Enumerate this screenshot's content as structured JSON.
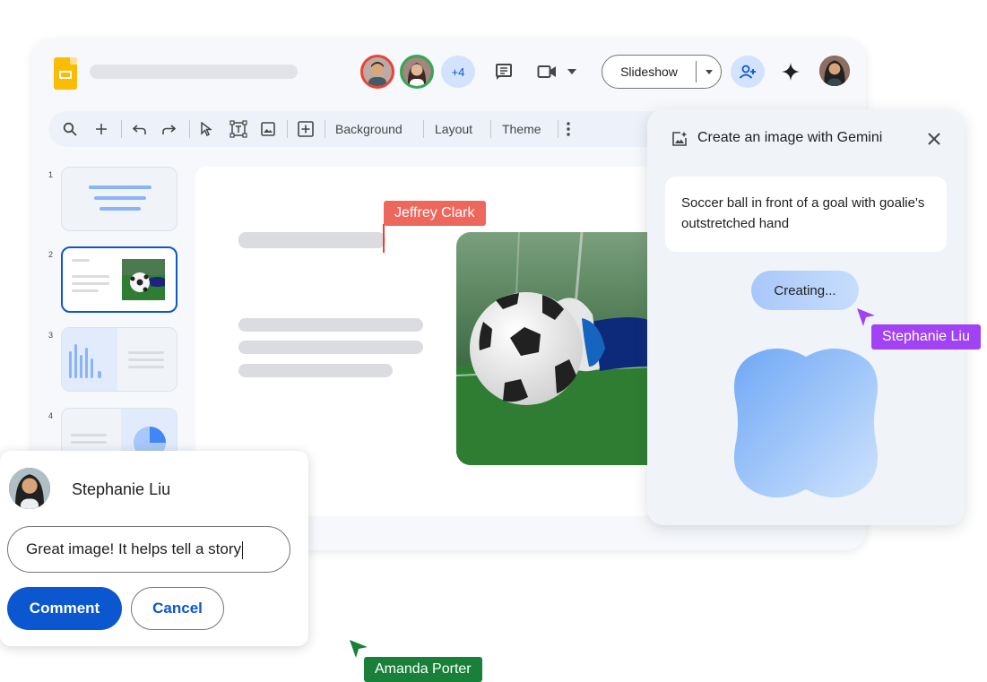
{
  "header": {
    "app_icon": "slides-logo-icon",
    "collaborators_extra": "+4",
    "slideshow_label": "Slideshow"
  },
  "toolbar": {
    "background_label": "Background",
    "layout_label": "Layout",
    "theme_label": "Theme"
  },
  "slides": {
    "numbers": [
      "1",
      "2",
      "3",
      "4"
    ],
    "selected": "2"
  },
  "cursors": {
    "jeffrey": "Jeffrey Clark",
    "stephanie": "Stephanie Liu",
    "amanda": "Amanda Porter"
  },
  "gemini": {
    "title": "Create an image with Gemini",
    "prompt": "Soccer ball in front of a goal with goalie's outstretched hand",
    "status": "Creating..."
  },
  "comment": {
    "author": "Stephanie Liu",
    "text": "Great image! It helps tell a story",
    "submit_label": "Comment",
    "cancel_label": "Cancel"
  },
  "colors": {
    "accent": "#0b57d0",
    "jeffrey_cursor": "#ee675c",
    "stephanie_cursor": "#a142f4",
    "amanda_cursor": "#188038"
  }
}
